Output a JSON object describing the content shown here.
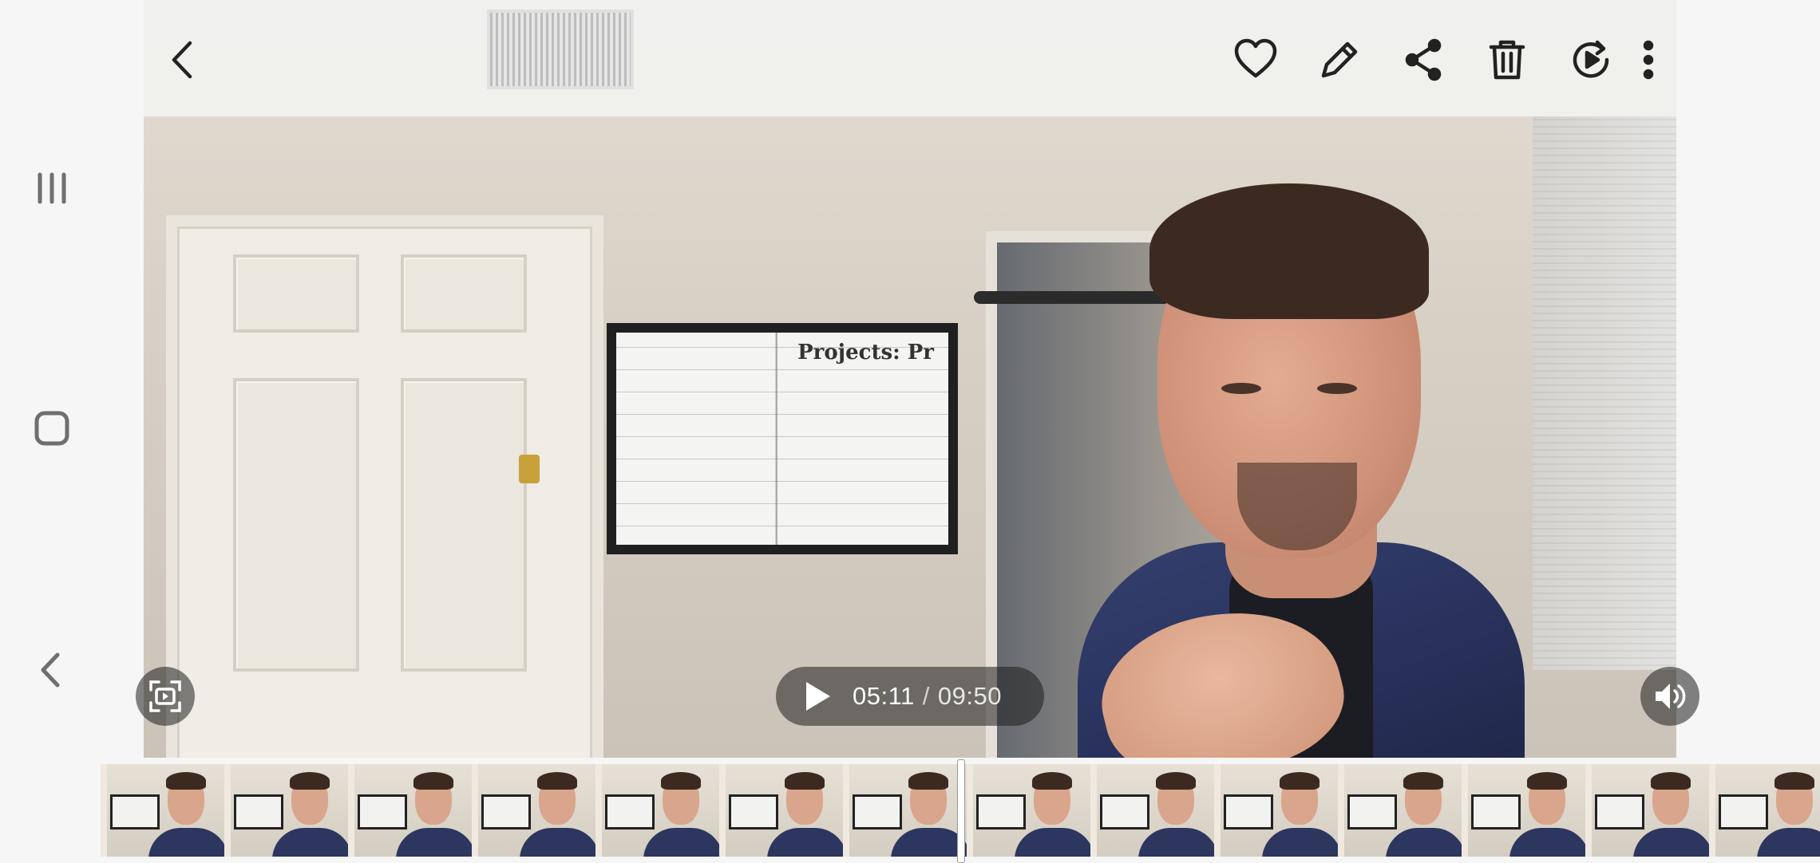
{
  "system_nav": {
    "recents": "recents-icon",
    "home": "home-icon",
    "back": "back-icon"
  },
  "toolbar": {
    "back": "back-arrow-icon",
    "favorite": "heart-icon",
    "edit": "pencil-icon",
    "share": "share-icon",
    "delete": "trash-icon",
    "motion": "replay-icon",
    "more": "more-vertical-icon"
  },
  "video": {
    "whiteboard_text": "Projects: Pr",
    "capture_icon": "screen-capture-icon",
    "volume_icon": "volume-icon"
  },
  "player": {
    "current_time": "05:11",
    "separator": "/",
    "duration": "09:50",
    "play_icon": "play-icon",
    "progress_fraction": 0.527
  },
  "filmstrip": {
    "thumbnail_count": 14
  },
  "colors": {
    "overlay": "#1e1e1e",
    "toolbar_bg": "#f0f0ee",
    "icon": "#222222"
  }
}
